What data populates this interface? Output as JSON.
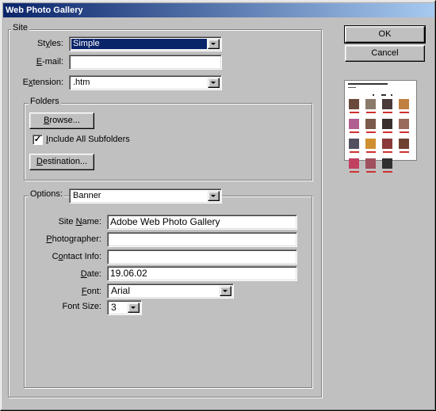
{
  "window": {
    "title": "Web Photo Gallery"
  },
  "buttons": {
    "ok": "OK",
    "cancel": "Cancel"
  },
  "site": {
    "group_label": "Site",
    "styles": {
      "label_pre": "St",
      "label_ul": "y",
      "label_post": "les:",
      "value": "Simple"
    },
    "email": {
      "label_pre": "",
      "label_ul": "E",
      "label_post": "-mail:",
      "value": ""
    },
    "extension": {
      "label_pre": "E",
      "label_ul": "x",
      "label_post": "tension:",
      "value": ".htm"
    }
  },
  "folders": {
    "group_label": "Folders",
    "browse": {
      "label_ul": "B",
      "label_post": "rowse..."
    },
    "include_subfolders": {
      "label_ul": "I",
      "label_post": "nclude All Subfolders",
      "checked": true,
      "mark": "✓"
    },
    "destination": {
      "label_ul": "D",
      "label_post": "estination..."
    }
  },
  "options": {
    "label": "Options:",
    "value": "Banner",
    "site_name": {
      "label_pre": "Site ",
      "label_ul": "N",
      "label_post": "ame:",
      "value": "Adobe Web Photo Gallery"
    },
    "photographer": {
      "label_ul": "P",
      "label_post": "hotographer:",
      "value": ""
    },
    "contact_info": {
      "label_pre": "C",
      "label_ul": "o",
      "label_post": "ntact Info:",
      "value": ""
    },
    "date": {
      "label_pre": "",
      "label_ul": "D",
      "label_post": "ate:",
      "value": "19.06.02"
    },
    "font": {
      "label_ul": "F",
      "label_post": "ont:",
      "value": "Arial"
    },
    "font_size": {
      "label": "Font Size:",
      "value": "3"
    }
  },
  "preview": {
    "thumb_colors": [
      "#6a4a3a",
      "#8a7a6a",
      "#4a3a3a",
      "#c08040",
      "#b06090",
      "#7a5a4a",
      "#3a3030",
      "#9a6a5a",
      "#505060",
      "#d09030",
      "#8a3a3a",
      "#704030",
      "#c04060",
      "#a05060",
      "#303030"
    ]
  }
}
